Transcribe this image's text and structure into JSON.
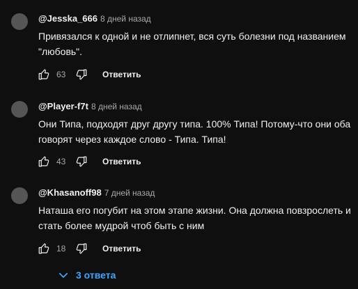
{
  "comments": [
    {
      "author": "@Jesska_666",
      "date": "8 дней назад",
      "text": "Привязался к одной и не отлипнет, вся суть болезни под названием \"любовь\".",
      "likes": "63",
      "reply_label": "Ответить"
    },
    {
      "author": "@Player-f7t",
      "date": "8 дней назад",
      "text": "Они Типа, подходят друг другу типа. 100% Типа! Потому-что они оба говорят через каждое слово - Типа. Типа!",
      "likes": "43",
      "reply_label": "Ответить"
    },
    {
      "author": "@Khasanoff98",
      "date": "7 дней назад",
      "text": "Наташа его погубит на этом этапе жизни. Она должна повзрослеть и стать более мудрой чтоб быть с ним",
      "likes": "18",
      "reply_label": "Ответить"
    }
  ],
  "replies_toggle": {
    "label": "3 ответа",
    "icon": "chevron-down-icon"
  },
  "colors": {
    "background": "#0f0f0f",
    "avatar": "#555555",
    "text": "#f1f1f1",
    "secondary_text": "#aaaaaa",
    "link": "#3ea6ff"
  },
  "icons": {
    "like": "thumb-up-icon",
    "dislike": "thumb-down-icon"
  }
}
